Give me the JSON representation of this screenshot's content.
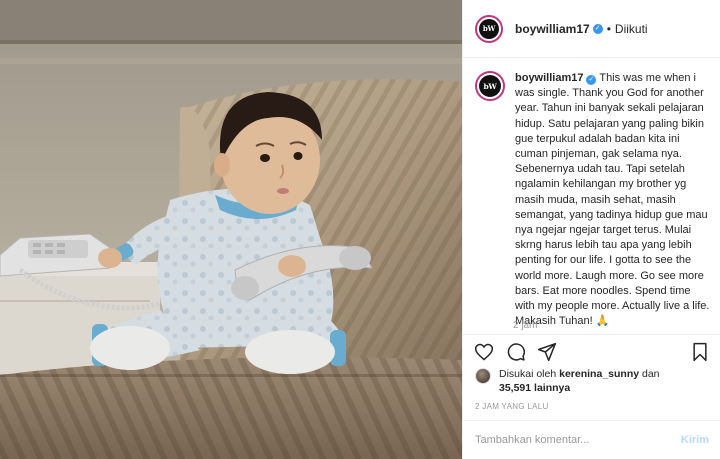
{
  "post": {
    "username": "boywilliam17",
    "follow_status": "Diikuti",
    "avatar_text": "bW",
    "caption": "This was me when i was single. Thank you God for another year. Tahun ini banyak sekali pelajaran hidup. Satu pelajaran yang paling bikin gue terpukul adalah badan kita ini cuman pinjeman, gak selama nya. Sebenernya udah tau. Tapi setelah ngalamin kehilangan my brother yg masih muda, masih sehat, masih semangat, yang tadinya hidup gue mau nya ngejar ngejar target terus. Mulai skrng harus lebih tau apa yang lebih penting for our life. I gotta to see the world more. Laugh more. Go see more bars. Eat more noodles. Spend time with my people more. Actually live a life. Makasih Tuhan! 🙏",
    "caption_time": "2 jam",
    "liked_by_prefix": "Disukai oleh",
    "liked_by_user": "kerenina_sunny",
    "liked_by_and": "dan",
    "likes_count": "35,591 lainnya",
    "timestamp": "2 JAM YANG LALU",
    "comment_placeholder": "Tambahkan komentar...",
    "post_button": "Kirim"
  },
  "icons": {
    "verified": "verified-badge",
    "like": "heart-icon",
    "comment": "comment-icon",
    "share": "share-icon",
    "save": "bookmark-icon"
  },
  "colors": {
    "verified": "#3897f0",
    "story_ring": "#c13584",
    "post_button": "#b3dbff",
    "muted": "#999999"
  }
}
